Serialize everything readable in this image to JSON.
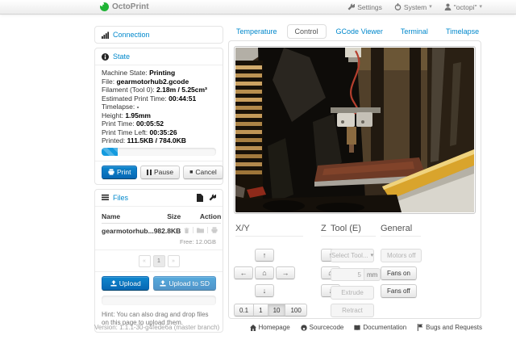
{
  "navbar": {
    "brand": "OctoPrint",
    "settings": "Settings",
    "system": "System",
    "user": "\"octopi\""
  },
  "sidebar": {
    "connection": {
      "title": "Connection"
    },
    "state": {
      "title": "State",
      "items": [
        {
          "label": "Machine State:",
          "value": "Printing"
        },
        {
          "label": "File:",
          "value": "gearmotorhub2.gcode"
        },
        {
          "label": "Filament (Tool 0):",
          "value": "2.18m / 5.25cm³"
        },
        {
          "label": "Estimated Print Time:",
          "value": "00:44:51"
        },
        {
          "label": "Timelapse:",
          "value": "-"
        },
        {
          "label": "Height:",
          "value": "1.95mm"
        },
        {
          "label": "Print Time:",
          "value": "00:05:52"
        },
        {
          "label": "Print Time Left:",
          "value": "00:35:26"
        },
        {
          "label": "Printed:",
          "value": "111.5KB / 784.0KB"
        }
      ],
      "progress_percent": 14,
      "print_button": "Print",
      "pause_button": "Pause",
      "cancel_button": "Cancel"
    },
    "files": {
      "title": "Files",
      "columns": {
        "name": "Name",
        "size": "Size",
        "action": "Action"
      },
      "rows": [
        {
          "name": "gearmotorhub...",
          "size": "982.8KB"
        }
      ],
      "free_space": "Free: 12.0GB",
      "pagination": {
        "prev": "«",
        "page": "1",
        "next": "»"
      },
      "upload_button": "Upload",
      "upload_sd_button": "Upload to SD",
      "hint": "Hint: You can also drag and drop files on this page to upload them."
    }
  },
  "tabs": [
    {
      "label": "Temperature"
    },
    {
      "label": "Control"
    },
    {
      "label": "GCode Viewer"
    },
    {
      "label": "Terminal"
    },
    {
      "label": "Timelapse"
    }
  ],
  "control": {
    "xy_header": "X/Y",
    "z_header": "Z",
    "tool_header": "Tool (E)",
    "general_header": "General",
    "steps": [
      "0.1",
      "1",
      "10",
      "100"
    ],
    "active_step": "10",
    "select_tool": "Select Tool...",
    "amount_value": "5",
    "amount_unit": "mm",
    "extrude_button": "Extrude",
    "retract_button": "Retract",
    "motors_off_button": "Motors off",
    "fans_on_button": "Fans on",
    "fans_off_button": "Fans off"
  },
  "footer": {
    "version": "Version: 1.1.1-30-g4fede6a (master branch)",
    "links": [
      "Homepage",
      "Sourcecode",
      "Documentation",
      "Bugs and Requests"
    ]
  },
  "icons": {
    "jog_up": "↑",
    "jog_down": "↓",
    "jog_left": "←",
    "jog_right": "→",
    "home": "⌂",
    "caret_down": "▾",
    "stop": "■"
  },
  "colors": {
    "accent_blue": "#0088cc",
    "primary_button_blue": "#0767b3",
    "progress_blue": "#149bdf",
    "octoprint_green": "#1fb335"
  }
}
